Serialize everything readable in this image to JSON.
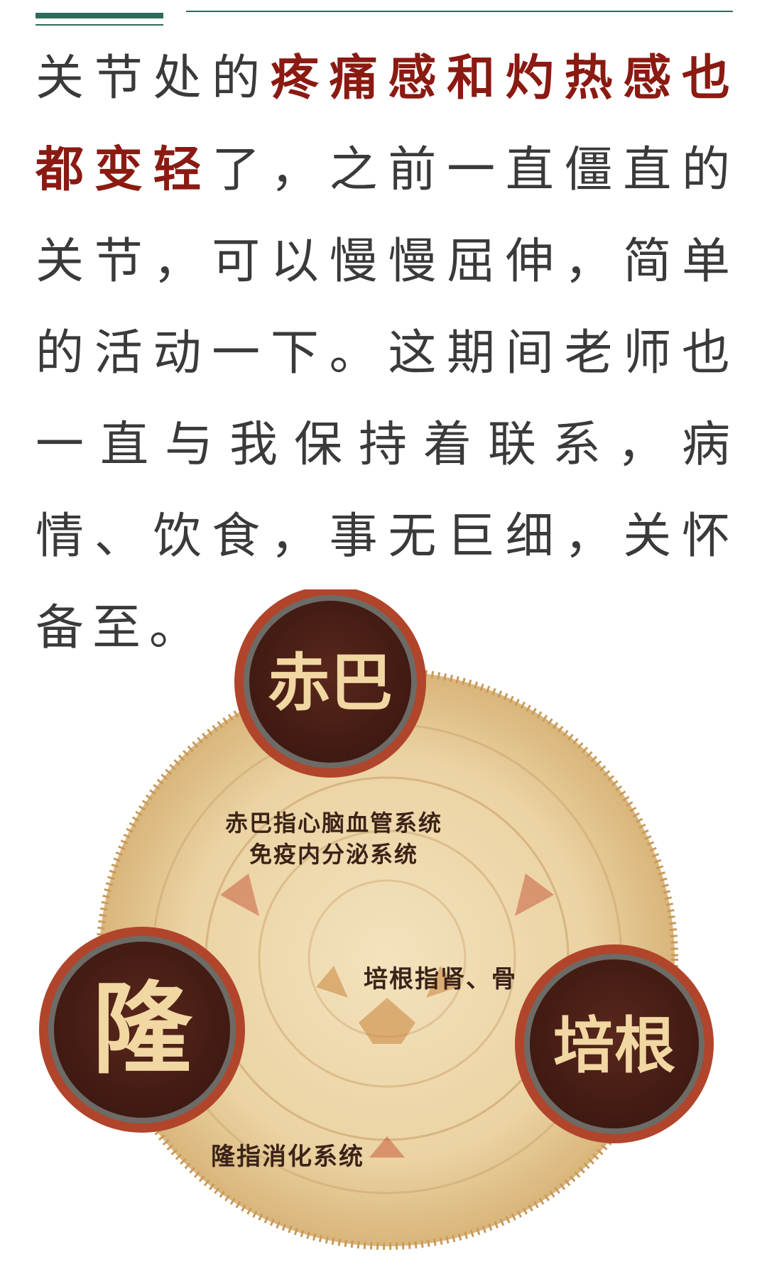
{
  "paragraph": {
    "part1": "关节处的",
    "emphasis": "疼痛感和灼热感也都变轻",
    "part2": "了，之前一直僵直的关节，可以慢慢屈伸，简单的活动一下。这期间老师也一直与我保持着联系，病情、饮食，事无巨细，关怀备至。"
  },
  "illustration": {
    "circle_top": "赤巴",
    "circle_left": "隆",
    "circle_right": "培根",
    "caption_chiba_line1": "赤巴指心脑血管系统",
    "caption_chiba_line2": "免疫内分泌系统",
    "caption_peigen": "培根指肾、骨",
    "caption_long": "隆指消化系统"
  },
  "colors": {
    "accent_green": "#2e6b5a",
    "emphasis_red": "#8a1a12",
    "disc": "#e9cf9e",
    "circle_fill": "#4b1f16",
    "circle_ring": "#b0452b",
    "glyph": "#f1d7a2"
  }
}
